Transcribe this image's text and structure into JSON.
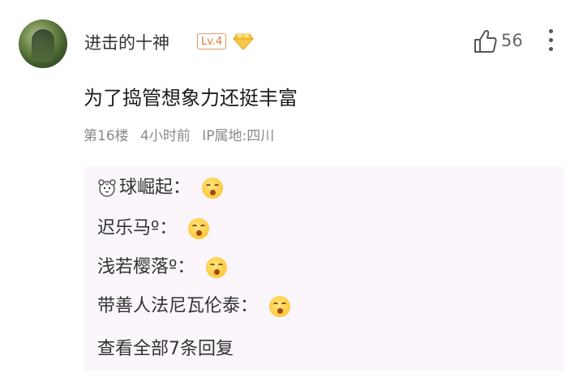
{
  "author": {
    "name": "进击的十神",
    "level": "Lv.4",
    "avatar_icon": "avatar-soldier",
    "badge_icon": "diamond-gem-icon"
  },
  "likes": {
    "count": "56",
    "icon": "thumb-up-icon"
  },
  "comment_text": "为了捣管想象力还挺丰富",
  "meta": {
    "floor": "第16楼",
    "time": "4小时前",
    "ip": "IP属地:四川"
  },
  "replies": [
    {
      "name": "球崛起",
      "prefix_icon": "tiger-face-icon",
      "emoji": "laughing-emoji"
    },
    {
      "name": "迟乐马º",
      "emoji": "laughing-emoji"
    },
    {
      "name": "浅若樱落º",
      "emoji": "laughing-emoji"
    },
    {
      "name": "带善人法尼瓦伦泰",
      "emoji": "laughing-emoji"
    }
  ],
  "reply_separator": "：",
  "view_all": "查看全部7条回复",
  "colors": {
    "level_badge": "#d97a3e",
    "reply_bg": "#faf6fb",
    "meta_text": "#8a8a8a"
  }
}
